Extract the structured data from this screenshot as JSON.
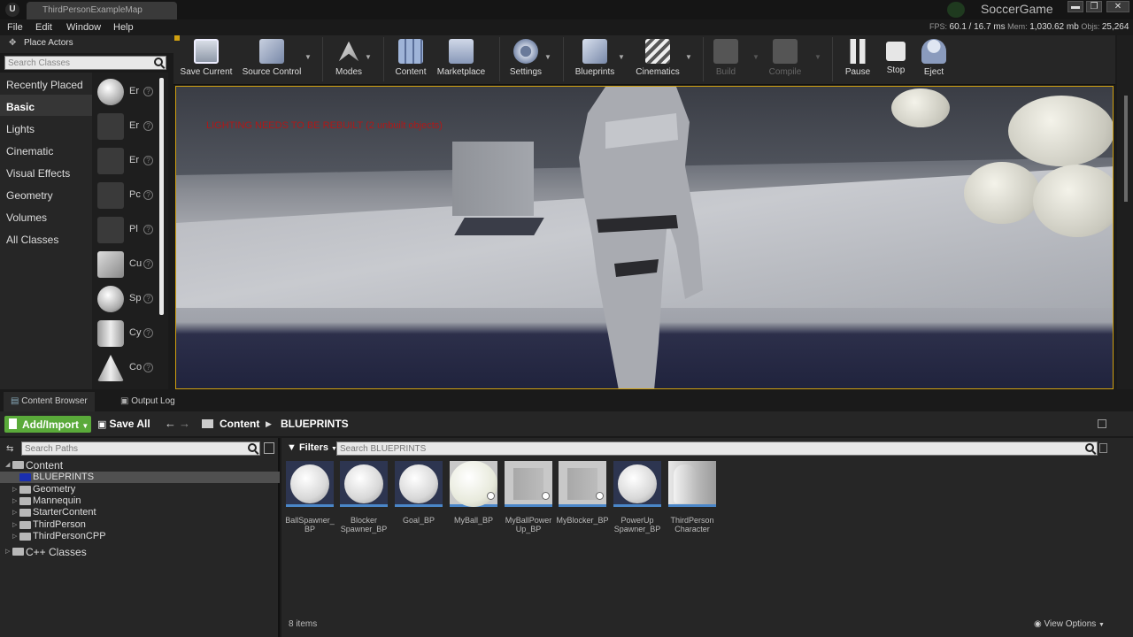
{
  "window": {
    "tab_title": "ThirdPersonExampleMap",
    "project_name": "SoccerGame",
    "minimize": "▬",
    "maximize": "❐",
    "close": "✕"
  },
  "menu": [
    "File",
    "Edit",
    "Window",
    "Help"
  ],
  "stats": {
    "fps_label": "FPS:",
    "fps": "60.1",
    "ms": "/ 16.7 ms",
    "mem_label": "Mem:",
    "mem": "1,030.62 mb",
    "objs_label": "Objs:",
    "objs": "25,264"
  },
  "place_actors": {
    "title": "Place Actors",
    "search_placeholder": "Search Classes",
    "categories": [
      "Recently Placed",
      "Basic",
      "Lights",
      "Cinematic",
      "Visual Effects",
      "Geometry",
      "Volumes",
      "All Classes"
    ],
    "active_category": "Basic",
    "items": [
      "Er",
      "Er",
      "Er",
      "Pc",
      "Pl",
      "Cu",
      "Sp",
      "Cy",
      "Co"
    ]
  },
  "toolbar": {
    "buttons": [
      {
        "label": "Save Current",
        "icon": "save-icon"
      },
      {
        "label": "Source Control",
        "icon": "source-control-icon"
      },
      {
        "label": "Modes",
        "icon": "modes-icon"
      },
      {
        "label": "Content",
        "icon": "content-icon"
      },
      {
        "label": "Marketplace",
        "icon": "marketplace-icon"
      },
      {
        "label": "Settings",
        "icon": "settings-icon"
      },
      {
        "label": "Blueprints",
        "icon": "blueprints-icon"
      },
      {
        "label": "Cinematics",
        "icon": "cinematics-icon"
      },
      {
        "label": "Build",
        "icon": "build-icon"
      },
      {
        "label": "Compile",
        "icon": "compile-icon"
      },
      {
        "label": "Pause",
        "icon": "pause-icon"
      },
      {
        "label": "Stop",
        "icon": "stop-icon"
      },
      {
        "label": "Eject",
        "icon": "eject-icon"
      }
    ]
  },
  "viewport": {
    "warning": "LIGHTING NEEDS TO BE REBUILT (2 unbuilt objects)"
  },
  "lower_tabs": [
    "Content Browser",
    "Output Log"
  ],
  "content_browser": {
    "add_import": "Add/Import",
    "save_all": "Save All",
    "breadcrumb": [
      "Content",
      "BLUEPRINTS"
    ],
    "search_paths_placeholder": "Search Paths",
    "filters": "Filters",
    "search_assets_placeholder": "Search BLUEPRINTS",
    "tree": [
      {
        "label": "Content",
        "level": 0
      },
      {
        "label": "BLUEPRINTS",
        "level": 1,
        "selected": true
      },
      {
        "label": "Geometry",
        "level": 1
      },
      {
        "label": "Mannequin",
        "level": 1
      },
      {
        "label": "StarterContent",
        "level": 1
      },
      {
        "label": "ThirdPerson",
        "level": 1
      },
      {
        "label": "ThirdPersonCPP",
        "level": 1
      },
      {
        "label": "C++ Classes",
        "level": 0
      }
    ],
    "assets": [
      {
        "line1": "BallSpawner_",
        "line2": "BP",
        "kind": "sphere"
      },
      {
        "line1": "Blocker",
        "line2": "Spawner_BP",
        "kind": "sphere"
      },
      {
        "line1": "Goal_BP",
        "line2": "",
        "kind": "sphere"
      },
      {
        "line1": "MyBall_BP",
        "line2": "",
        "kind": "sphere-light"
      },
      {
        "line1": "MyBallPower",
        "line2": "Up_BP",
        "kind": "box"
      },
      {
        "line1": "MyBlocker_BP",
        "line2": "",
        "kind": "box"
      },
      {
        "line1": "PowerUp",
        "line2": "Spawner_BP",
        "kind": "sphere"
      },
      {
        "line1": "ThirdPerson",
        "line2": "Character",
        "kind": "character"
      }
    ],
    "item_count": "8 items",
    "view_options": "View Options"
  },
  "colors": {
    "accent_green": "#5aaa3a",
    "viewport_border": "#d0a010",
    "warning_red": "#b01818"
  }
}
